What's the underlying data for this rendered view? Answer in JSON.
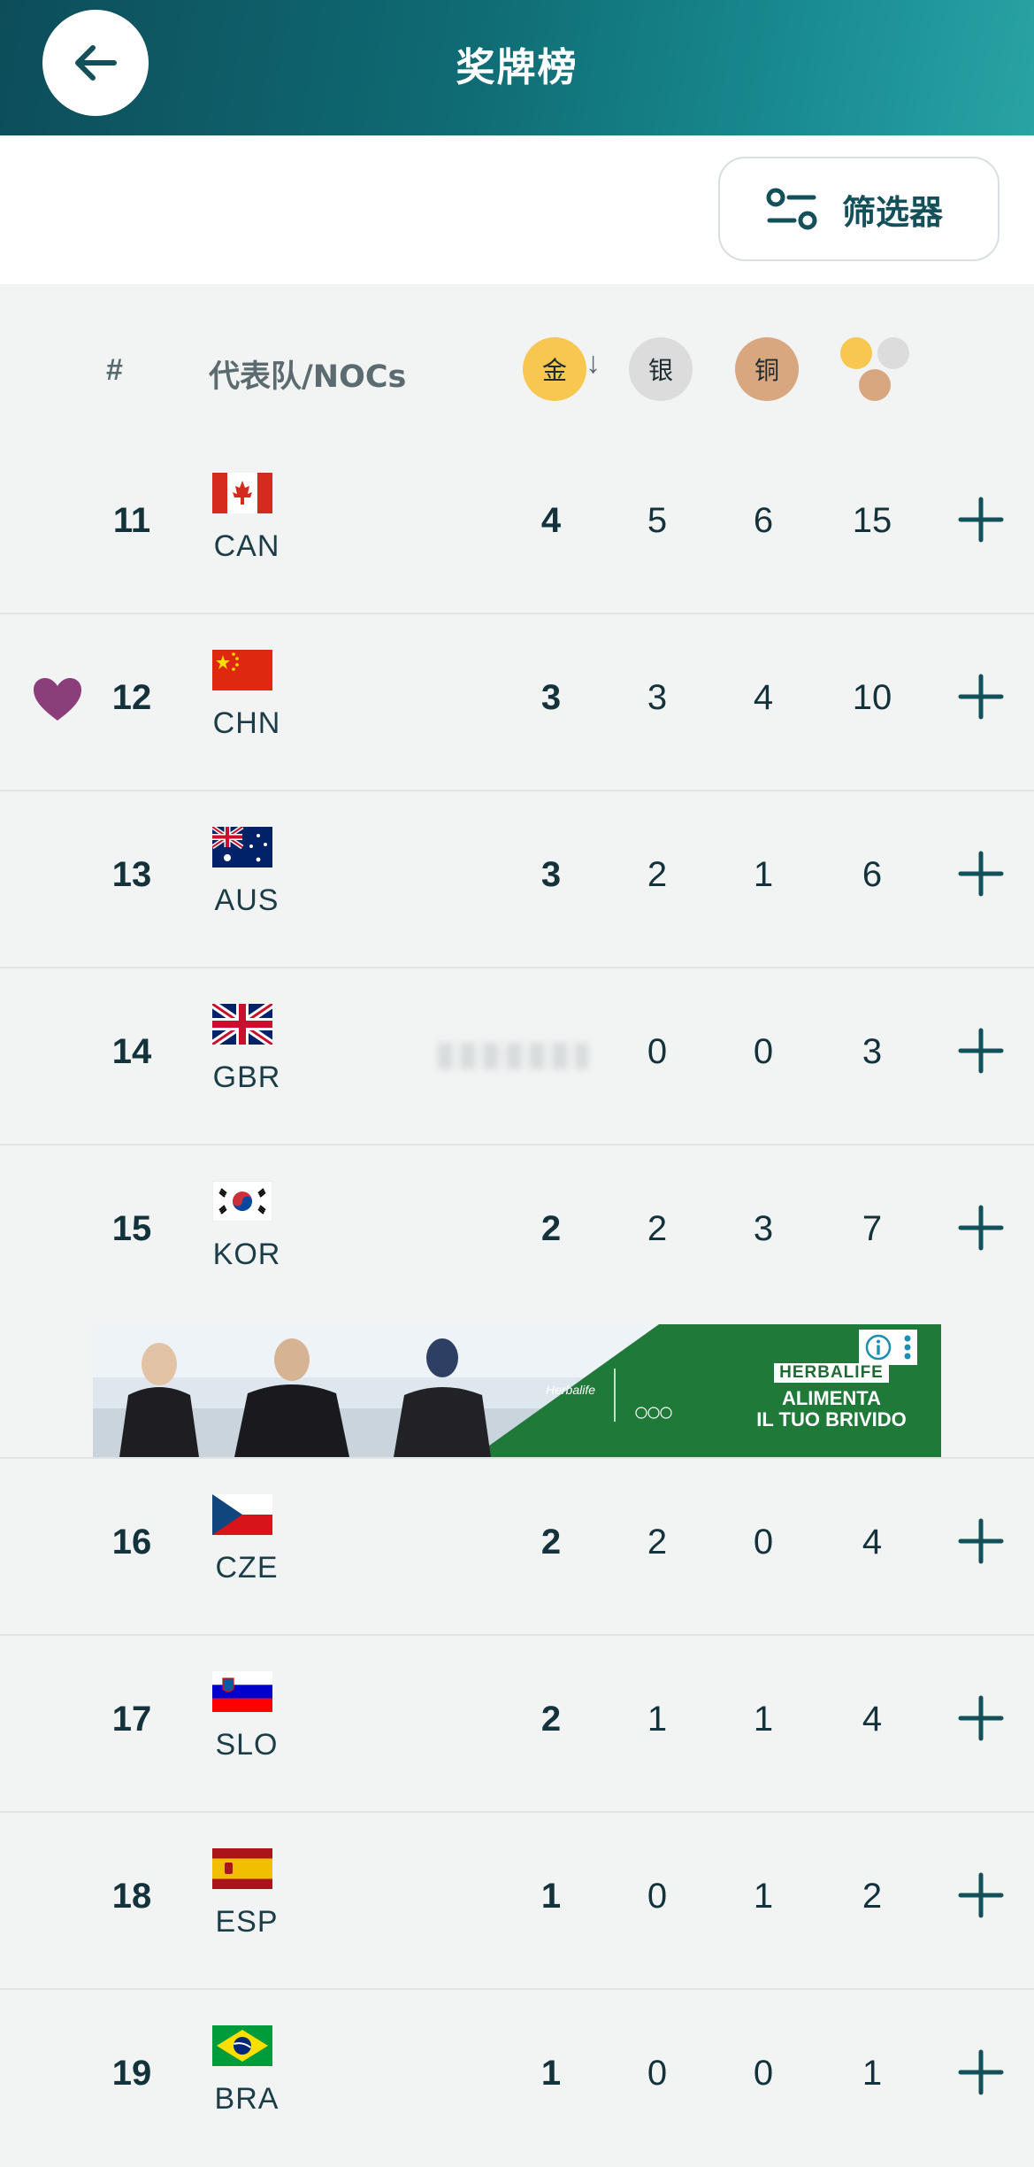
{
  "header": {
    "title": "奖牌榜",
    "back_icon": "arrow-left-icon"
  },
  "filter": {
    "label": "筛选器",
    "icon": "sliders-icon"
  },
  "table_header": {
    "rank": "#",
    "noc": "代表队/NOCs",
    "gold": "金",
    "silver": "银",
    "bronze": "铜",
    "sort_indicator": "↓",
    "total_icon": "medal-dots-icon"
  },
  "colors": {
    "gold": "#f7c74f",
    "silver": "#dcdcdc",
    "bronze": "#d9a77f",
    "accent": "#14505a",
    "favorite": "#8b3f7a"
  },
  "rows": [
    {
      "rank": "11",
      "code": "CAN",
      "gold": "4",
      "silver": "5",
      "bronze": "6",
      "total": "15"
    },
    {
      "rank": "12",
      "code": "CHN",
      "gold": "3",
      "silver": "3",
      "bronze": "4",
      "total": "10",
      "favorite": true
    },
    {
      "rank": "13",
      "code": "AUS",
      "gold": "3",
      "silver": "2",
      "bronze": "1",
      "total": "6"
    },
    {
      "rank": "14",
      "code": "GBR",
      "gold": "",
      "silver": "0",
      "bronze": "0",
      "total": "3"
    },
    {
      "rank": "15",
      "code": "KOR",
      "gold": "2",
      "silver": "2",
      "bronze": "3",
      "total": "7"
    },
    {
      "rank": "16",
      "code": "CZE",
      "gold": "2",
      "silver": "2",
      "bronze": "0",
      "total": "4"
    },
    {
      "rank": "17",
      "code": "SLO",
      "gold": "2",
      "silver": "1",
      "bronze": "1",
      "total": "4"
    },
    {
      "rank": "18",
      "code": "ESP",
      "gold": "1",
      "silver": "0",
      "bronze": "1",
      "total": "2"
    },
    {
      "rank": "19",
      "code": "BRA",
      "gold": "1",
      "silver": "0",
      "bronze": "0",
      "total": "1"
    }
  ],
  "ad": {
    "brand": "Herbalife",
    "headline": "HERBALIFE",
    "tagline_1": "ALIMENTA",
    "tagline_2": "IL TUO BRIVIDO"
  }
}
